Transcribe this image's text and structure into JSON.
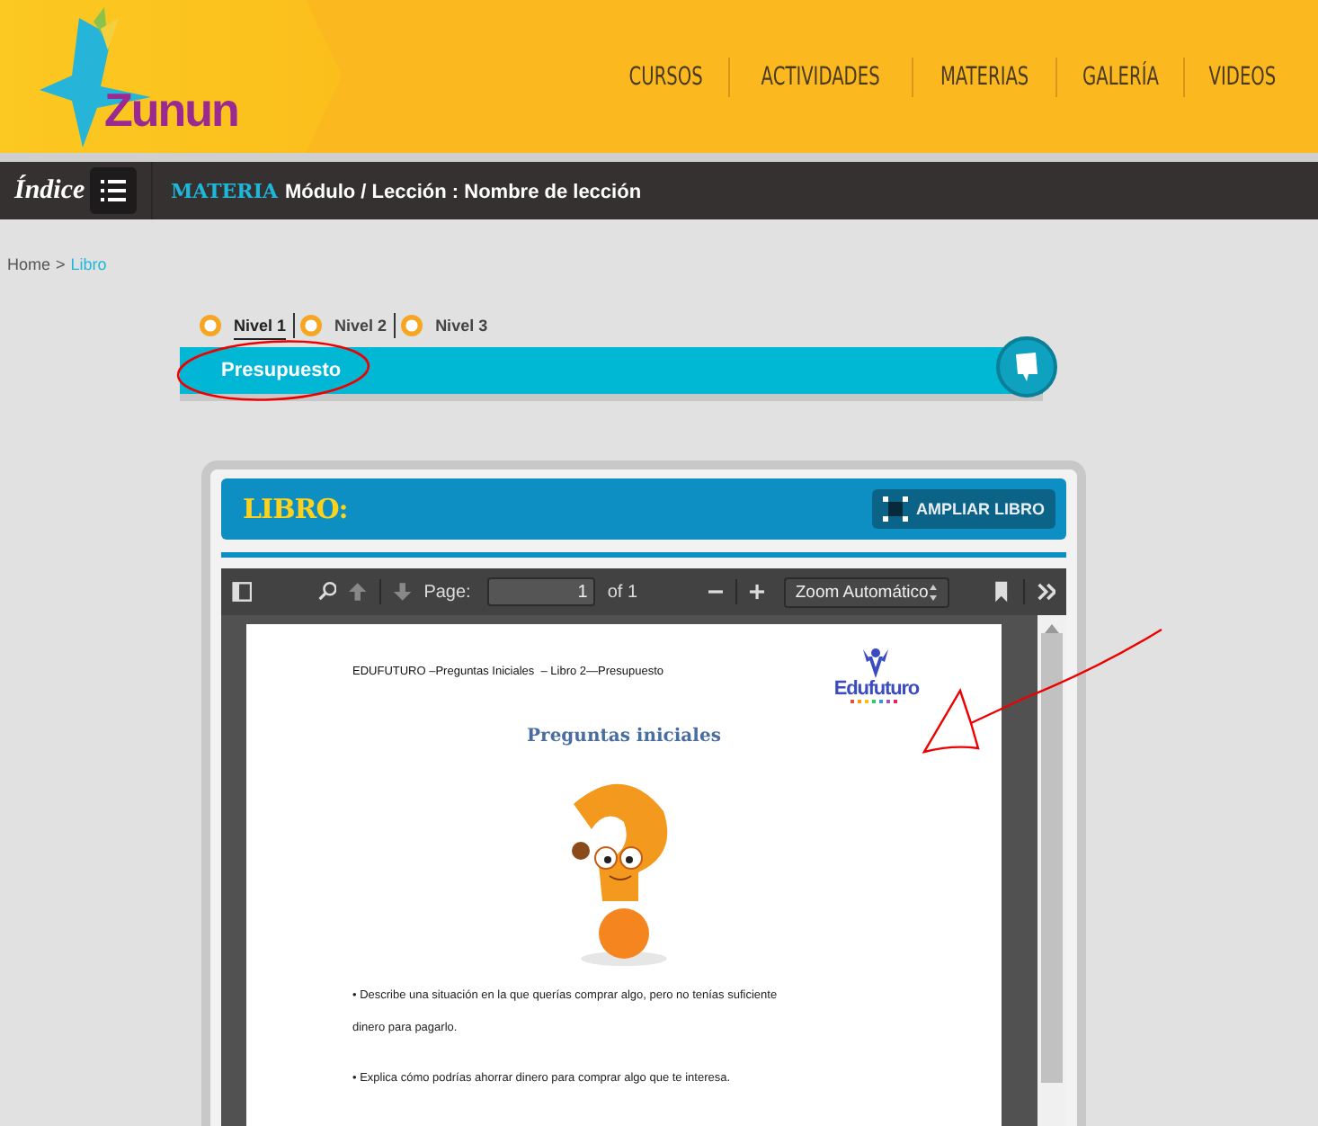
{
  "header": {
    "logo": "Zunun",
    "nav": [
      "CURSOS",
      "ACTIVIDADES",
      "MATERIAS",
      "GALERÍA",
      "VIDEOS"
    ]
  },
  "subbar": {
    "index_label": "Índice",
    "subject": "MATERIA",
    "lesson_path": "Módulo / Lección : Nombre de lección"
  },
  "breadcrumb": {
    "home": "Home",
    "separator": ">",
    "current": "Libro"
  },
  "levels": [
    {
      "label": "Nivel 1",
      "selected": true
    },
    {
      "label": "Nivel 2",
      "selected": false
    },
    {
      "label": "Nivel 3",
      "selected": false
    }
  ],
  "topic": {
    "label": "Presupuesto"
  },
  "book": {
    "title": "LIBRO:",
    "expand_button": "AMPLIAR LIBRO",
    "toolbar": {
      "page_label": "Page:",
      "page_value": "1",
      "page_count": "of 1",
      "zoom": "Zoom Automático"
    },
    "document": {
      "running_header": "EDUFUTURO –Preguntas Iniciales  – Libro 2—Presupuesto",
      "brand": "Edufuturo",
      "heading": "Preguntas iniciales",
      "paragraphs": [
        "• Describe una situación en la que querías comprar algo, pero no tenías suficiente dinero para pagarlo.",
        "• Explica cómo podrías ahorrar dinero para comprar algo que te interesa."
      ]
    }
  }
}
